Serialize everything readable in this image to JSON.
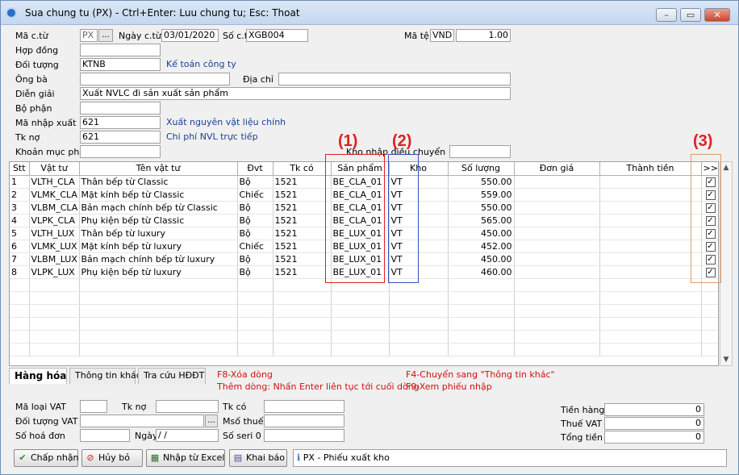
{
  "window": {
    "title": "Sua chung tu (PX) - Ctrl+Enter: Luu chung tu; Esc: Thoat",
    "minimize_glyph": "–",
    "restore_glyph": "▭",
    "close_glyph": "✕"
  },
  "header": {
    "ma_ct_label": "Mã c.từ",
    "ma_ct_value": "PX",
    "browse_label": "...",
    "ngay_ct_label": "Ngày c.từ",
    "ngay_ct_value": "03/01/2020",
    "so_ct_label": "Số c.từ",
    "so_ct_value": "XGB004",
    "ma_te_label": "Mã tệ",
    "ma_te_value": "VND",
    "ty_gia_value": "1.00",
    "hop_dong_label": "Hợp đồng",
    "hop_dong_value": "",
    "doi_tuong_label": "Đối tượng",
    "doi_tuong_value": "KTNB",
    "doi_tuong_name": "Kế toán công ty",
    "ong_ba_label": "Ông bà",
    "ong_ba_value": "",
    "dia_chi_label": "Địa chỉ",
    "dia_chi_value": "",
    "dien_giai_label": "Diễn giải",
    "dien_giai_value": "Xuất NVLC đi sản xuất sản phẩm",
    "bo_phan_label": "Bộ phận",
    "bo_phan_value": "",
    "ma_nhap_xuat_label": "Mã nhập xuất",
    "ma_nhap_xuat_value": "621",
    "ma_nhap_xuat_name": "Xuất nguyên vật liệu chính",
    "tk_no_label": "Tk nợ",
    "tk_no_value": "621",
    "tk_no_name": "Chi phí NVL trực tiếp",
    "khoan_muc_phi_label": "Khoản mục phí",
    "khoan_muc_phi_value": "",
    "kho_nhap_dieu_chuyen_label": "Kho nhập điều chuyển",
    "kho_nhap_dieu_chuyen_value": ""
  },
  "grid": {
    "columns": [
      "Stt",
      "Vật tư",
      "Tên vật tư",
      "Đvt",
      "Tk có",
      "Sản phẩm",
      "Kho",
      "Số lượng",
      "Đơn giá",
      "Thành tiền",
      ">>"
    ],
    "rows": [
      {
        "stt": "1",
        "vat_tu": "VLTH_CLA",
        "ten": "Thân bếp từ Classic",
        "dvt": "Bộ",
        "tk_co": "1521",
        "san_pham": "BE_CLA_01",
        "kho": "VT",
        "so_luong": "550.00",
        "don_gia": "",
        "thanh_tien": "",
        "checked": "✓"
      },
      {
        "stt": "2",
        "vat_tu": "VLMK_CLA",
        "ten": "Mặt kính bếp từ Classic",
        "dvt": "Chiếc",
        "tk_co": "1521",
        "san_pham": "BE_CLA_01",
        "kho": "VT",
        "so_luong": "559.00",
        "don_gia": "",
        "thanh_tien": "",
        "checked": "✓"
      },
      {
        "stt": "3",
        "vat_tu": "VLBM_CLA",
        "ten": "Bản mạch chính bếp từ Classic",
        "dvt": "Bộ",
        "tk_co": "1521",
        "san_pham": "BE_CLA_01",
        "kho": "VT",
        "so_luong": "550.00",
        "don_gia": "",
        "thanh_tien": "",
        "checked": "✓"
      },
      {
        "stt": "4",
        "vat_tu": "VLPK_CLA",
        "ten": "Phụ kiện bếp từ Classic",
        "dvt": "Bộ",
        "tk_co": "1521",
        "san_pham": "BE_CLA_01",
        "kho": "VT",
        "so_luong": "565.00",
        "don_gia": "",
        "thanh_tien": "",
        "checked": "✓"
      },
      {
        "stt": "5",
        "vat_tu": "VLTH_LUX",
        "ten": "Thân bếp từ luxury",
        "dvt": "Bộ",
        "tk_co": "1521",
        "san_pham": "BE_LUX_01",
        "kho": "VT",
        "so_luong": "450.00",
        "don_gia": "",
        "thanh_tien": "",
        "checked": "✓"
      },
      {
        "stt": "6",
        "vat_tu": "VLMK_LUX",
        "ten": "Mặt kính bếp từ luxury",
        "dvt": "Chiếc",
        "tk_co": "1521",
        "san_pham": "BE_LUX_01",
        "kho": "VT",
        "so_luong": "452.00",
        "don_gia": "",
        "thanh_tien": "",
        "checked": "✓"
      },
      {
        "stt": "7",
        "vat_tu": "VLBM_LUX",
        "ten": "Bản mạch chính bếp từ luxury",
        "dvt": "Bộ",
        "tk_co": "1521",
        "san_pham": "BE_LUX_01",
        "kho": "VT",
        "so_luong": "450.00",
        "don_gia": "",
        "thanh_tien": "",
        "checked": "✓"
      },
      {
        "stt": "8",
        "vat_tu": "VLPK_LUX",
        "ten": "Phụ kiện bếp từ luxury",
        "dvt": "Bộ",
        "tk_co": "1521",
        "san_pham": "BE_LUX_01",
        "kho": "VT",
        "so_luong": "460.00",
        "don_gia": "",
        "thanh_tien": "",
        "checked": "✓"
      }
    ],
    "scroll_up": "▲",
    "scroll_down": "▼"
  },
  "annotations": {
    "mark1": "(1)",
    "mark2": "(2)",
    "mark3": "(3)",
    "color_red": "#e02020",
    "color_blue": "#3a4fb8",
    "color_orange": "#d9a070"
  },
  "tabs": {
    "hang_hoa": "Hàng hóa",
    "thong_tin_khac": "Thông tin khác",
    "tra_cuu_hddt": "Tra cứu HĐĐT"
  },
  "hints": {
    "f8": "F8-Xóa dòng",
    "them_dong": "Thêm dòng: Nhấn Enter liên tục tới cuối dòng",
    "f4": "F4-Chuyển sang \"Thông tin khác\"",
    "f9": "F9-Xem phiếu nhập"
  },
  "vat": {
    "ma_loai_vat_label": "Mã loại VAT",
    "ma_loai_vat_value": "",
    "tk_no_label": "Tk nợ",
    "tk_no_value": "",
    "tk_co_label": "Tk có",
    "tk_co_value": "",
    "doi_tuong_vat_label": "Đối tượng VAT",
    "doi_tuong_vat_value": "",
    "ms_thue_label": "Msố thuế",
    "ms_thue_value": "",
    "so_hoa_don_label": "Số hoá đơn",
    "so_hoa_don_value": "",
    "ngay_label": "Ngày",
    "ngay_value": "  /  /",
    "so_seri_label": "Số seri 0",
    "so_seri_value": ""
  },
  "totals": {
    "tien_hang_label": "Tiền hàng",
    "tien_hang_value": "0",
    "thue_vat_label": "Thuế VAT",
    "thue_vat_value": "0",
    "tong_tien_label": "Tổng tiền",
    "tong_tien_value": "0"
  },
  "buttons": {
    "chap_nhan": "Chấp nhận",
    "huy_bo": "Hủy bỏ",
    "nhap_tu_excel": "Nhập từ Excel",
    "khai_bao": "Khai báo",
    "status_text": "PX - Phiếu xuất kho"
  }
}
